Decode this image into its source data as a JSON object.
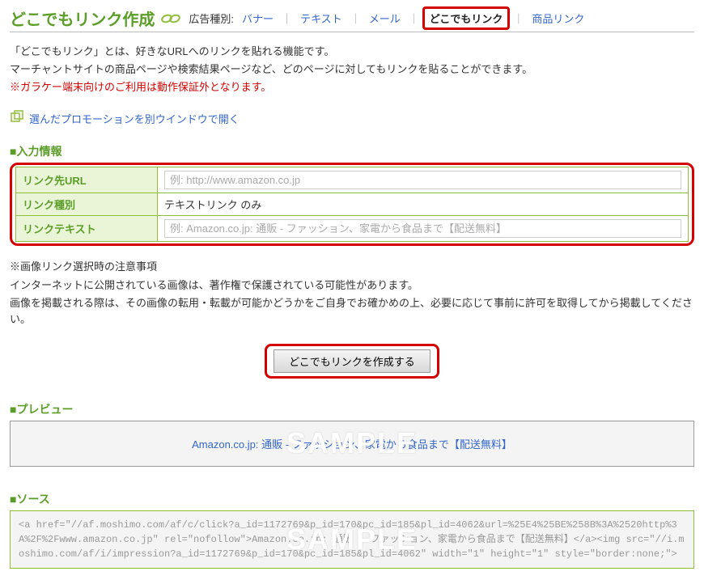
{
  "header": {
    "title": "どこでもリンク作成",
    "adtype_label": "広告種別:",
    "nav": {
      "banner": "バナー",
      "text": "テキスト",
      "mail": "メール",
      "anywhere": "どこでもリンク",
      "product": "商品リンク"
    }
  },
  "intro": {
    "line1": "「どこでもリンク」とは、好きなURLへのリンクを貼れる機能です。",
    "line2": "マーチャントサイトの商品ページや検索結果ページなど、どのページに対してもリンクを貼ることができます。",
    "warn": "※ガラケー端末向けのご利用は動作保証外となります。"
  },
  "open_window_link": "選んだプロモーションを別ウインドウで開く",
  "sections": {
    "input": "■入力情報",
    "preview": "■プレビュー",
    "source": "■ソース"
  },
  "input_table": {
    "url_label": "リンク先URL",
    "url_placeholder": "例: http://www.amazon.co.jp",
    "type_label": "リンク種別",
    "type_value": "テキストリンク のみ",
    "text_label": "リンクテキスト",
    "text_placeholder": "例: Amazon.co.jp: 通販 - ファッション、家電から食品まで【配送無料】"
  },
  "image_note": {
    "title": "※画像リンク選択時の注意事項",
    "line1": "インターネットに公開されている画像は、著作権で保護されている可能性があります。",
    "line2": "画像を掲載される際は、その画像の転用・転載が可能かどうかをご自身でお確かめの上、必要に応じて事前に許可を取得してから掲載してください。"
  },
  "create_button": "どこでもリンクを作成する",
  "preview_text": "Amazon.co.jp: 通販 - ファッション、家電から食品まで【配送無料】",
  "sample_label": "SAMPLE",
  "source_code": "<a href=\"//af.moshimo.com/af/c/click?a_id=1172769&p_id=170&pc_id=185&pl_id=4062&url=%25E4%25BE%258B%3A%2520http%3A%2F%2Fwww.amazon.co.jp\" rel=\"nofollow\">Amazon.co.jp: 通販 - ファッション、家電から食品まで【配送無料】</a><img src=\"//i.moshimo.com/af/i/impression?a_id=1172769&p_id=170&pc_id=185&pl_id=4062\" width=\"1\" height=\"1\" style=\"border:none;\">"
}
